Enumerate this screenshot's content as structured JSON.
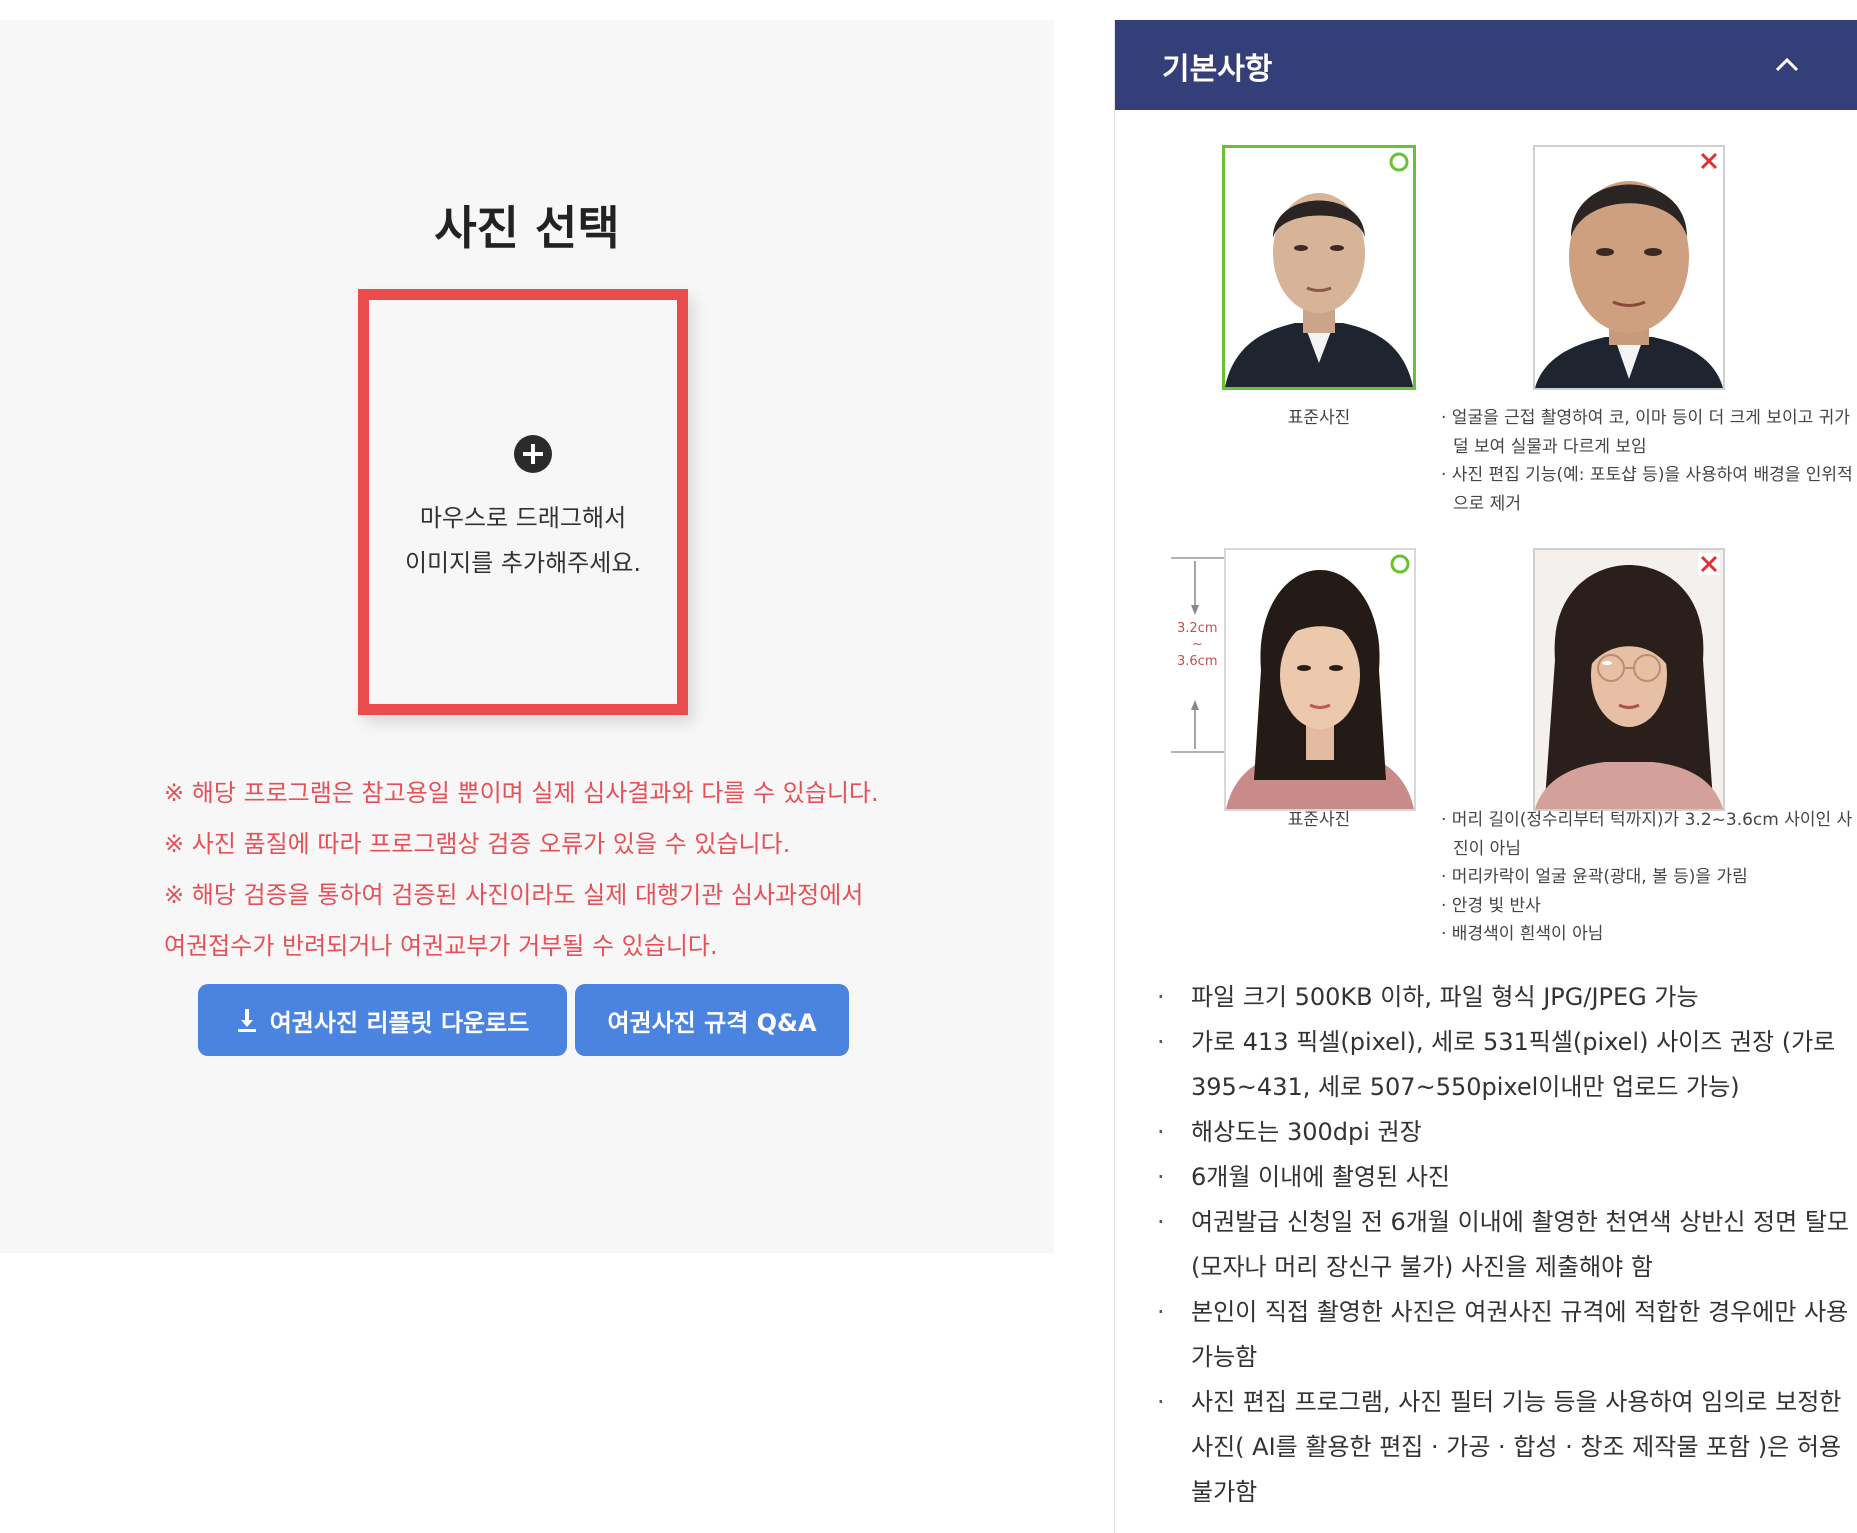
{
  "upload": {
    "title": "사진 선택",
    "drop_line1": "마우스로 드래그해서",
    "drop_line2": "이미지를 추가해주세요."
  },
  "notices": [
    "※ 해당 프로그램은 참고용일 뿐이며 실제 심사결과와 다를 수 있습니다.",
    "※ 사진 품질에 따라 프로그램상 검증 오류가 있을 수 있습니다.",
    "※ 해당 검증을 통하여 검증된 사진이라도 실제 대행기관 심사과정에서",
    "여권접수가 반려되거나 여권교부가 거부될 수 있습니다."
  ],
  "buttons": {
    "download": "여권사진 리플릿 다운로드",
    "qa": "여권사진 규격 Q&A"
  },
  "panel": {
    "title": "기본사항",
    "caption_standard_1": "표준사진",
    "caption_standard_2": "표준사진",
    "measure_top": "3.2cm",
    "measure_mid": "~",
    "measure_bottom": "3.6cm",
    "notes_1": [
      "· 얼굴을 근접 촬영하여 코, 이마 등이 더 크게 보이고 귀가 덜 보여 실물과 다르게 보임",
      "· 사진 편집 기능(예: 포토샵 등)을 사용하여 배경을 인위적으로 제거"
    ],
    "notes_2": [
      "· 머리 길이(정수리부터 턱까지)가 3.2~3.6cm 사이인 사진이 아님",
      "· 머리카락이 얼굴 윤곽(광대, 볼 등)을 가림",
      "· 안경 빛 반사",
      "· 배경색이 흰색이 아님"
    ]
  },
  "requirements": [
    "파일 크기 500KB 이하, 파일 형식 JPG/JPEG 가능",
    "가로 413 픽셀(pixel), 세로 531픽셀(pixel) 사이즈 권장 (가로 395~431, 세로 507~550pixel이내만 업로드 가능)",
    "해상도는 300dpi 권장",
    "6개월 이내에 촬영된 사진",
    "여권발급 신청일 전 6개월 이내에 촬영한 천연색 상반신 정면 탈모 (모자나 머리 장신구 불가) 사진을 제출해야 함",
    "본인이 직접 촬영한 사진은 여권사진 규격에 적합한 경우에만 사용 가능함",
    "사진 편집 프로그램, 사진 필터 기능 등을 사용하여 임의로 보정한 사진( AI를 활용한 편집 · 가공 · 합성 · 창조 제작물 포함 )은 허용 불가함"
  ],
  "colors": {
    "accent_blue": "#4b84e0",
    "header_navy": "#343e78",
    "warning_red": "#e65157",
    "drop_border": "#ea4b4c",
    "good_mark": "#69c234",
    "bad_mark": "#e03030"
  }
}
